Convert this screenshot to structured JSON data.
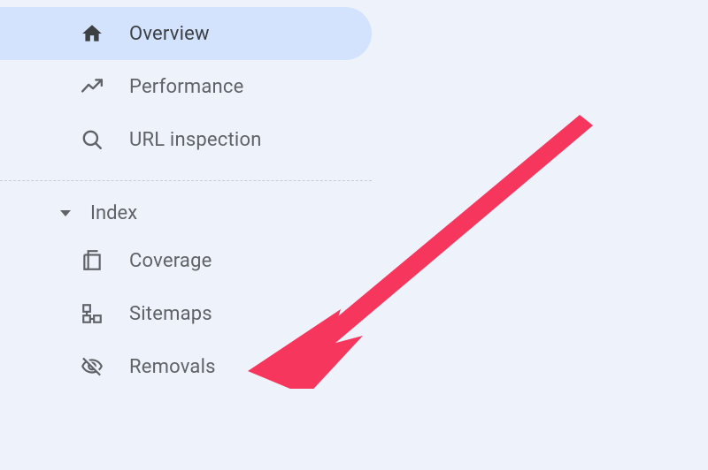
{
  "sidebar": {
    "items": [
      {
        "label": "Overview",
        "icon": "home-icon",
        "active": true
      },
      {
        "label": "Performance",
        "icon": "trending-icon",
        "active": false
      },
      {
        "label": "URL inspection",
        "icon": "search-icon",
        "active": false
      }
    ],
    "section": {
      "label": "Index",
      "items": [
        {
          "label": "Coverage",
          "icon": "pages-icon"
        },
        {
          "label": "Sitemaps",
          "icon": "sitemap-icon"
        },
        {
          "label": "Removals",
          "icon": "visibility-off-icon"
        }
      ]
    }
  },
  "annotation": {
    "color": "#f7365e"
  }
}
